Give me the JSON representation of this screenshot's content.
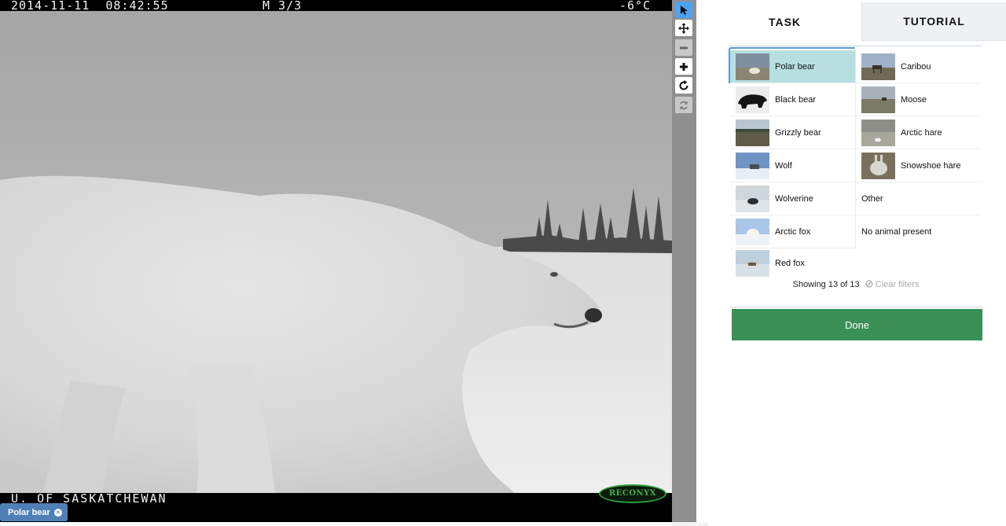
{
  "camera": {
    "timestamp": "2014-11-11  08:42:55",
    "frame": "M 3/3",
    "temperature": "-6°C",
    "owner": "U. OF SASKATCHEWAN",
    "brand": "RECONYX"
  },
  "tools": [
    {
      "name": "pointer",
      "active": true
    },
    {
      "name": "pan"
    },
    {
      "name": "zoom-out",
      "disabled": true
    },
    {
      "name": "zoom-in"
    },
    {
      "name": "rotate"
    },
    {
      "name": "reset",
      "disabled": true
    }
  ],
  "tabs": {
    "task": "TASK",
    "tutorial": "TUTORIAL"
  },
  "choices": [
    {
      "label": "Polar bear",
      "selected": true,
      "thumb": "polar-bear"
    },
    {
      "label": "Caribou",
      "thumb": "caribou"
    },
    {
      "label": "Black bear",
      "thumb": "black-bear"
    },
    {
      "label": "Moose",
      "thumb": "moose"
    },
    {
      "label": "Grizzly bear",
      "thumb": "grizzly-bear"
    },
    {
      "label": "Arctic hare",
      "thumb": "arctic-hare"
    },
    {
      "label": "Wolf",
      "thumb": "wolf"
    },
    {
      "label": "Snowshoe hare",
      "thumb": "snowshoe-hare"
    },
    {
      "label": "Wolverine",
      "thumb": "wolverine"
    },
    {
      "label": "Other"
    },
    {
      "label": "Arctic fox",
      "thumb": "arctic-fox"
    },
    {
      "label": "No animal present"
    },
    {
      "label": "Red fox",
      "thumb": "red-fox"
    }
  ],
  "filter": {
    "showing": "Showing 13 of 13",
    "clear": "Clear filters"
  },
  "done_label": "Done",
  "selected_tag": {
    "label": "Polar bear",
    "remove": "×"
  }
}
